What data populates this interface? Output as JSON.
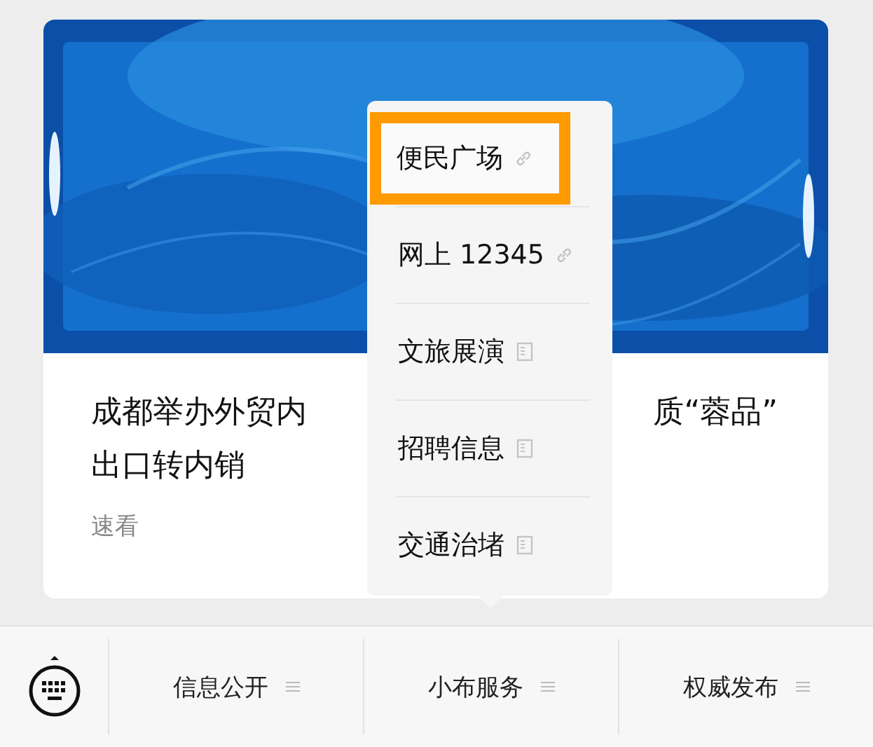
{
  "article": {
    "title_parts": [
      "成都举办外贸内",
      "质“蓉品”",
      "出口转内销"
    ],
    "tag": "速看"
  },
  "popup_menu": {
    "items": [
      {
        "label": "便民广场",
        "kind": "link",
        "highlighted": true
      },
      {
        "label": "网上 12345",
        "kind": "link",
        "highlighted": false
      },
      {
        "label": "文旅展演",
        "kind": "page",
        "highlighted": false
      },
      {
        "label": "招聘信息",
        "kind": "page",
        "highlighted": false
      },
      {
        "label": "交通治堵",
        "kind": "page",
        "highlighted": false
      }
    ]
  },
  "bottom_menu": {
    "items": [
      {
        "label": "信息公开"
      },
      {
        "label": "小布服务"
      },
      {
        "label": "权威发布"
      }
    ]
  }
}
